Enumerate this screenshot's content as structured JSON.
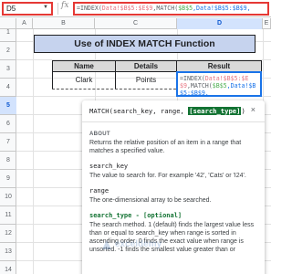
{
  "name_box": {
    "value": "D5"
  },
  "formula_bar": {
    "fx": "fx",
    "parts": [
      {
        "text": "=INDEX(",
        "color": "gray"
      },
      {
        "text": "Data!$B$5:$E$9",
        "color": "red"
      },
      {
        "text": ",MATCH(",
        "color": "gray"
      },
      {
        "text": "$B$5",
        "color": "green"
      },
      {
        "text": ",Data!$B$5:$B$9,",
        "color": "blue"
      }
    ]
  },
  "columns": [
    {
      "label": "A",
      "active": false
    },
    {
      "label": "B",
      "active": false
    },
    {
      "label": "C",
      "active": false
    },
    {
      "label": "D",
      "active": true
    },
    {
      "label": "E",
      "active": false
    }
  ],
  "rows": [
    {
      "label": "1",
      "active": false
    },
    {
      "label": "2",
      "active": false
    },
    {
      "label": "3",
      "active": false
    },
    {
      "label": "4",
      "active": false
    },
    {
      "label": "5",
      "active": true
    },
    {
      "label": "6",
      "active": false
    },
    {
      "label": "7",
      "active": false
    },
    {
      "label": "8",
      "active": false
    },
    {
      "label": "9",
      "active": false
    },
    {
      "label": "10",
      "active": false
    },
    {
      "label": "11",
      "active": false
    },
    {
      "label": "12",
      "active": false
    },
    {
      "label": "13",
      "active": false
    },
    {
      "label": "14",
      "active": false
    }
  ],
  "sheet": {
    "title": "Use of INDEX MATCH Function",
    "headers": {
      "name": "Name",
      "details": "Details",
      "result": "Result"
    },
    "row5": {
      "name": "Clark",
      "details": "Points"
    }
  },
  "edit_cell": {
    "parts": [
      {
        "text": "=INDEX(",
        "color": "gray"
      },
      {
        "text": "Data!$B$5:$E$9",
        "color": "red"
      },
      {
        "text": ",MATCH(",
        "color": "gray"
      },
      {
        "text": "$B$5",
        "color": "green"
      },
      {
        "text": ",Data!$B$5:$B$9,",
        "color": "blue"
      }
    ]
  },
  "tooltip": {
    "signature_prefix": "MATCH(search_key, range, ",
    "signature_active": "[search_type]",
    "signature_suffix": ")",
    "close_glyph": "×",
    "about_label": "ABOUT",
    "about_text": "Returns the relative position of an item in a range that matches a specified value.",
    "args": [
      {
        "name": "search_key",
        "text": "The value to search for. For example '42', 'Cats' or 'I24'.",
        "active": false
      },
      {
        "name": "range",
        "text": "The one-dimensional array to be searched.",
        "active": false
      },
      {
        "name": "search_type - [optional]",
        "text": "The search method. 1 (default) finds the largest value less than or equal to search_key when range is sorted in ascending order. 0 finds the exact value when range is unsorted. -1 finds the smallest value greater than or",
        "active": true
      }
    ]
  },
  "watermark": {
    "text": "exceldemy"
  },
  "colors": {
    "red_highlight": "#e53935",
    "title_fill": "#c6d3ee",
    "header_fill": "#d9d9d9",
    "selection_blue": "#1a73e8",
    "active_arg_green": "#137333"
  }
}
